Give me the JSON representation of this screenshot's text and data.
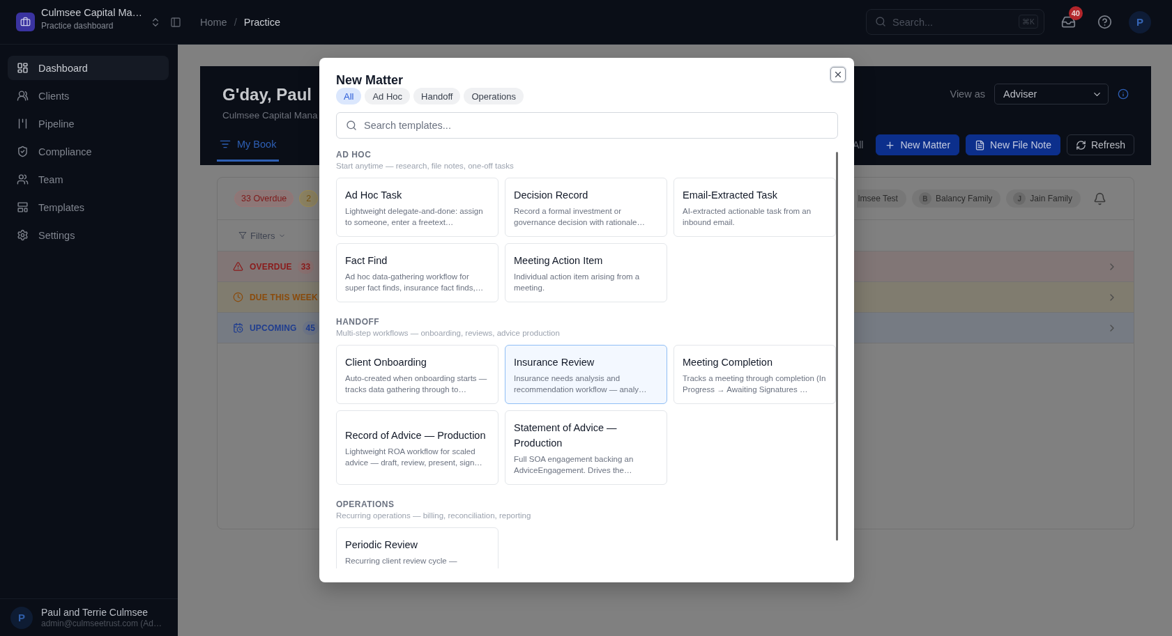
{
  "topbar": {
    "org_name": "Culmsee Capital Ma…",
    "org_subtitle": "Practice dashboard",
    "breadcrumb": {
      "items": [
        {
          "label": "Home",
          "current": false
        },
        {
          "label": "Practice",
          "current": true
        }
      ],
      "separator": "/"
    },
    "search": {
      "placeholder": "Search...",
      "shortcut": "⌘K"
    },
    "inbox_count": "40",
    "avatar_initial": "P"
  },
  "sidebar": {
    "items": [
      {
        "label": "Dashboard",
        "selected": true
      },
      {
        "label": "Clients",
        "selected": false
      },
      {
        "label": "Pipeline",
        "selected": false
      },
      {
        "label": "Compliance",
        "selected": false
      },
      {
        "label": "Team",
        "selected": false
      },
      {
        "label": "Templates",
        "selected": false
      },
      {
        "label": "Settings",
        "selected": false
      }
    ],
    "user": {
      "initial": "P",
      "name": "Paul and Terrie Culmsee",
      "email": "admin@culmseetrust.com (Ad…"
    }
  },
  "hero": {
    "greeting": "G'day, Paul",
    "subtitle": "Culmsee Capital Mana",
    "tabs": [
      {
        "label": "My Book",
        "selected": true
      }
    ],
    "view_as": {
      "label": "View as",
      "value": "Adviser"
    },
    "partial_label": "All",
    "actions": [
      {
        "label": "New Matter",
        "kind": "primary"
      },
      {
        "label": "New File Note",
        "kind": "primary"
      },
      {
        "label": "Refresh",
        "kind": "outline"
      }
    ]
  },
  "panel": {
    "status_chips": [
      {
        "label": "33 Overdue",
        "kind": "danger"
      },
      {
        "label": "2",
        "kind": "warning"
      }
    ],
    "client_chips": [
      {
        "label": "lmsee Test"
      },
      {
        "initial": "B",
        "label": "Balancy Family"
      },
      {
        "initial": "J",
        "label": "Jain Family"
      }
    ],
    "filters": "Filters",
    "groups": [
      {
        "label": "OVERDUE",
        "kind": "danger",
        "count": "33"
      },
      {
        "label": "DUE THIS WEEK",
        "kind": "warning"
      },
      {
        "label": "UPCOMING",
        "kind": "info",
        "count": "45"
      }
    ]
  },
  "modal": {
    "title": "New Matter",
    "tabs": [
      {
        "label": "All",
        "selected": true
      },
      {
        "label": "Ad Hoc",
        "selected": false
      },
      {
        "label": "Handoff",
        "selected": false
      },
      {
        "label": "Operations",
        "selected": false
      }
    ],
    "search": {
      "placeholder": "Search templates..."
    },
    "sections": [
      {
        "heading": "AD HOC",
        "description": "Start anytime — research, file notes, one-off tasks",
        "templates": [
          {
            "title": "Ad Hoc Task",
            "description": "Lightweight delegate-and-done: assign to someone, enter a freetext…",
            "selected": false
          },
          {
            "title": "Decision Record",
            "description": "Record a formal investment or governance decision with rationale…",
            "selected": false
          },
          {
            "title": "Email-Extracted Task",
            "description": "AI-extracted actionable task from an inbound email.",
            "selected": false
          },
          {
            "title": "Fact Find",
            "description": "Ad hoc data-gathering workflow for super fact finds, insurance fact finds,…",
            "selected": false
          },
          {
            "title": "Meeting Action Item",
            "description": "Individual action item arising from a meeting.",
            "selected": false
          }
        ]
      },
      {
        "heading": "HANDOFF",
        "description": "Multi-step workflows — onboarding, reviews, advice production",
        "templates": [
          {
            "title": "Client Onboarding",
            "description": "Auto-created when onboarding starts — tracks data gathering through to…",
            "selected": false
          },
          {
            "title": "Insurance Review",
            "description": "Insurance needs analysis and recommendation workflow — analy…",
            "selected": true
          },
          {
            "title": "Meeting Completion",
            "description": "Tracks a meeting through completion (In Progress → Awaiting Signatures …",
            "selected": false
          },
          {
            "title": "Record of Advice — Production",
            "description": "Lightweight ROA workflow for scaled advice — draft, review, present, sign…",
            "selected": false
          },
          {
            "title": "Statement of Advice — Production",
            "description": "Full SOA engagement backing an AdviceEngagement. Drives the…",
            "selected": false
          }
        ]
      },
      {
        "heading": "OPERATIONS",
        "description": "Recurring operations — billing, reconciliation, reporting",
        "templates": [
          {
            "title": "Periodic Review",
            "description": "Recurring client review cycle —",
            "selected": false
          }
        ]
      }
    ]
  }
}
